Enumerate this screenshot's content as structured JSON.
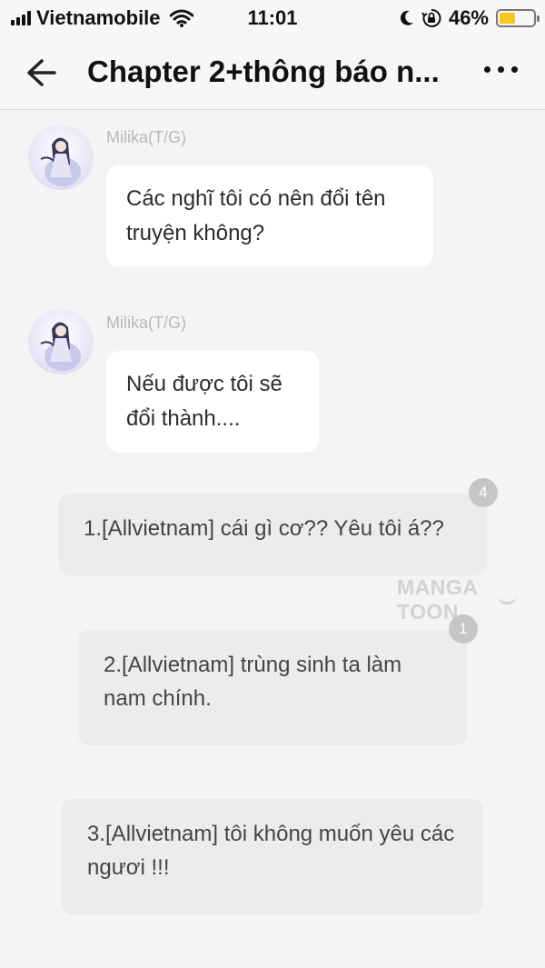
{
  "status_bar": {
    "carrier": "Vietnamobile",
    "time": "11:01",
    "battery_percent_text": "46%",
    "battery_level": 0.46,
    "icons": [
      "signal-icon",
      "wifi-icon",
      "moon-icon",
      "orientation-lock-icon",
      "battery-icon"
    ]
  },
  "header": {
    "title": "Chapter 2+thông báo n...",
    "back_icon": "arrow-left-icon",
    "more_icon": "more-dots-icon"
  },
  "messages": [
    {
      "sender": "Milika(T/G)",
      "text": "Các nghĩ tôi có nên đổi tên truyện không?"
    },
    {
      "sender": "Milika(T/G)",
      "text": "Nếu được tôi sẽ đổi thành...."
    }
  ],
  "notes": [
    {
      "text": "1.[Allvietnam] cái gì cơ?? Yêu tôi á??",
      "count": "4"
    },
    {
      "text": "2.[Allvietnam] trùng sinh ta làm nam chính.",
      "count": "1"
    },
    {
      "text": "3.[Allvietnam] tôi không muốn yêu các ngươi !!!"
    }
  ],
  "watermark": "MANGA TOON"
}
